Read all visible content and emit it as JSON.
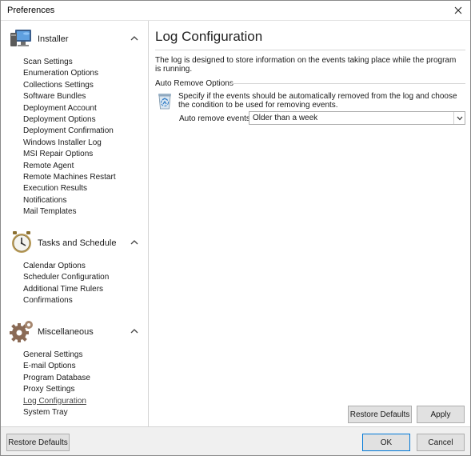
{
  "window": {
    "title": "Preferences"
  },
  "sidebar": {
    "groups": [
      {
        "label": "Installer",
        "icon": "monitor-icon",
        "items": [
          "Scan Settings",
          "Enumeration Options",
          "Collections Settings",
          "Software Bundles",
          "Deployment Account",
          "Deployment Options",
          "Deployment Confirmation",
          "Windows Installer Log",
          "MSI Repair Options",
          "Remote Agent",
          "Remote Machines Restart",
          "Execution Results",
          "Notifications",
          "Mail Templates"
        ]
      },
      {
        "label": "Tasks and Schedule",
        "icon": "clock-icon",
        "items": [
          "Calendar Options",
          "Scheduler Configuration",
          "Additional Time Rulers",
          "Confirmations"
        ]
      },
      {
        "label": "Miscellaneous",
        "icon": "gears-icon",
        "items": [
          "General Settings",
          "E-mail Options",
          "Program Database",
          "Proxy Settings",
          "Log Configuration",
          "System Tray"
        ]
      }
    ],
    "active_item": "Log Configuration"
  },
  "main": {
    "title": "Log Configuration",
    "description": "The log is designed to store information on the events taking place while the program is running.",
    "section": {
      "title": "Auto Remove Options",
      "description": "Specify if the events should be automatically removed from the log and choose the condition to be used for removing events.",
      "field_label": "Auto remove events:",
      "field_value": "Older than a week"
    },
    "restore_label": "Restore Defaults",
    "apply_label": "Apply"
  },
  "footer": {
    "restore_label": "Restore Defaults",
    "ok_label": "OK",
    "cancel_label": "Cancel"
  },
  "colors": {
    "accent": "#0078d7"
  }
}
